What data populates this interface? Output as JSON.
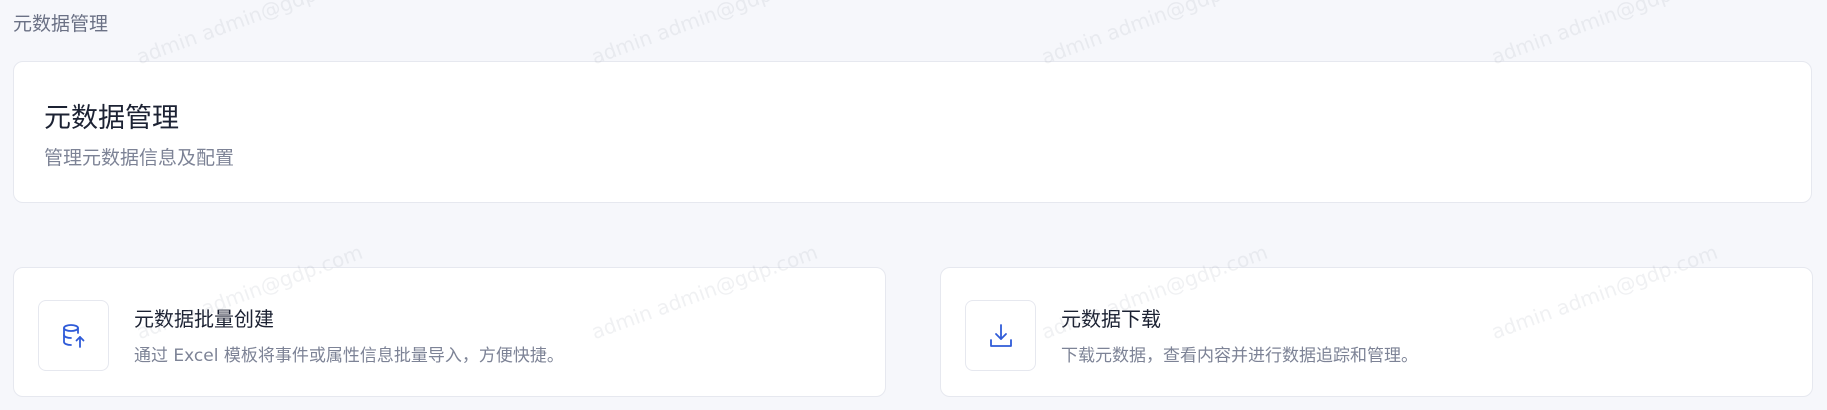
{
  "breadcrumb": "元数据管理",
  "header": {
    "title": "元数据管理",
    "subtitle": "管理元数据信息及配置"
  },
  "cards": [
    {
      "title": "元数据批量创建",
      "description": "通过 Excel 模板将事件或属性信息批量导入，方便快捷。",
      "icon": "database-upload-icon"
    },
    {
      "title": "元数据下载",
      "description": "下载元数据，查看内容并进行数据追踪和管理。",
      "icon": "download-icon"
    }
  ],
  "watermark": "admin admin@gdp.com",
  "colors": {
    "accent": "#2f5bd8",
    "background": "#f6f7fb",
    "card": "#ffffff",
    "title_text": "#1c2233",
    "muted_text": "#7d8396"
  }
}
